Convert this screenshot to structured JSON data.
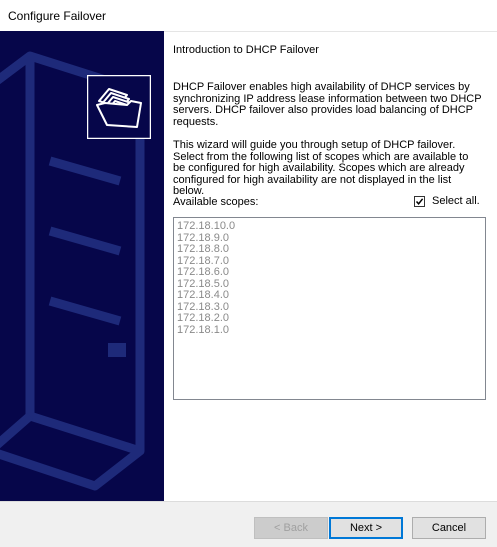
{
  "window": {
    "title": "Configure Failover"
  },
  "page": {
    "title": "Introduction to DHCP Failover",
    "paragraph1": "DHCP Failover enables high availability of DHCP services by synchronizing IP address lease information between two DHCP servers. DHCP failover also provides load balancing of DHCP requests.",
    "paragraph2": "This wizard will guide you through setup of DHCP failover. Select from the following list of scopes which are available to be configured for high availability. Scopes which are already configured for high availability are not displayed in the list below.",
    "scopes_label": "Available scopes:",
    "select_all_label": "Select all.",
    "select_all_checked": true
  },
  "scopes": [
    "172.18.10.0",
    "172.18.9.0",
    "172.18.8.0",
    "172.18.7.0",
    "172.18.6.0",
    "172.18.5.0",
    "172.18.4.0",
    "172.18.3.0",
    "172.18.2.0",
    "172.18.1.0"
  ],
  "buttons": {
    "back": "< Back",
    "next": "Next >",
    "cancel": "Cancel"
  },
  "colors": {
    "banner": "#06064a",
    "accent": "#0078d7"
  },
  "icons": {
    "wizard": "folders-icon",
    "checkbox": "checkmark-icon"
  }
}
